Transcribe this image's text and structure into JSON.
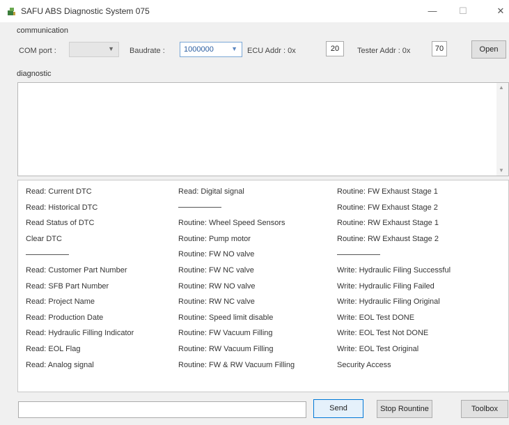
{
  "window": {
    "title": "SAFU ABS Diagnostic System 075",
    "min_glyph": "—",
    "max_glyph": "☐",
    "close_glyph": "✕",
    "icon": "app-icon"
  },
  "communication": {
    "group_label": "communication",
    "com_port_label": "COM port :",
    "com_port_value": "",
    "baudrate_label": "Baudrate :",
    "baudrate_value": "1000000",
    "ecu_addr_label": "ECU Addr : 0x",
    "ecu_addr_value": "20",
    "tester_addr_label": "Tester Addr : 0x",
    "tester_addr_value": "70",
    "open_label": "Open"
  },
  "diagnostic": {
    "group_label": "diagnostic",
    "log_text": ""
  },
  "commands": {
    "col1": [
      "Read: Current DTC",
      "Read: Historical DTC",
      "Read Status of DTC",
      "Clear DTC",
      "",
      "Read: Customer Part Number",
      "Read: SFB Part Number",
      "Read: Project Name",
      "Read: Production Date",
      "Read: Hydraulic Filling Indicator",
      "Read: EOL Flag",
      "Read: Analog signal"
    ],
    "col2": [
      "Read: Digital signal",
      "",
      "Routine: Wheel Speed Sensors",
      "Routine: Pump motor",
      "Routine: FW NO valve",
      "Routine: FW NC valve",
      "Routine: RW NO valve",
      "Routine: RW NC valve",
      "Routine: Speed limit disable",
      "Routine: FW Vacuum Filling",
      "Routine: RW Vacuum Filling",
      "Routine: FW & RW Vacuum Filling"
    ],
    "col3": [
      "Routine: FW Exhaust Stage 1",
      "Routine: FW Exhaust Stage 2",
      "Routine: RW Exhaust Stage 1",
      "Routine: RW Exhaust Stage 2",
      "",
      "Write: Hydraulic Filing Successful",
      "Write: Hydraulic Filing Failed",
      "Write: Hydraulic Filing Original",
      "Write: EOL Test DONE",
      "Write: EOL Test Not DONE",
      "Write: EOL Test Original",
      "Security Access"
    ]
  },
  "bottom": {
    "command_input_value": "",
    "send_label": "Send",
    "stop_label": "Stop Rountine",
    "toolbox_label": "Toolbox"
  }
}
